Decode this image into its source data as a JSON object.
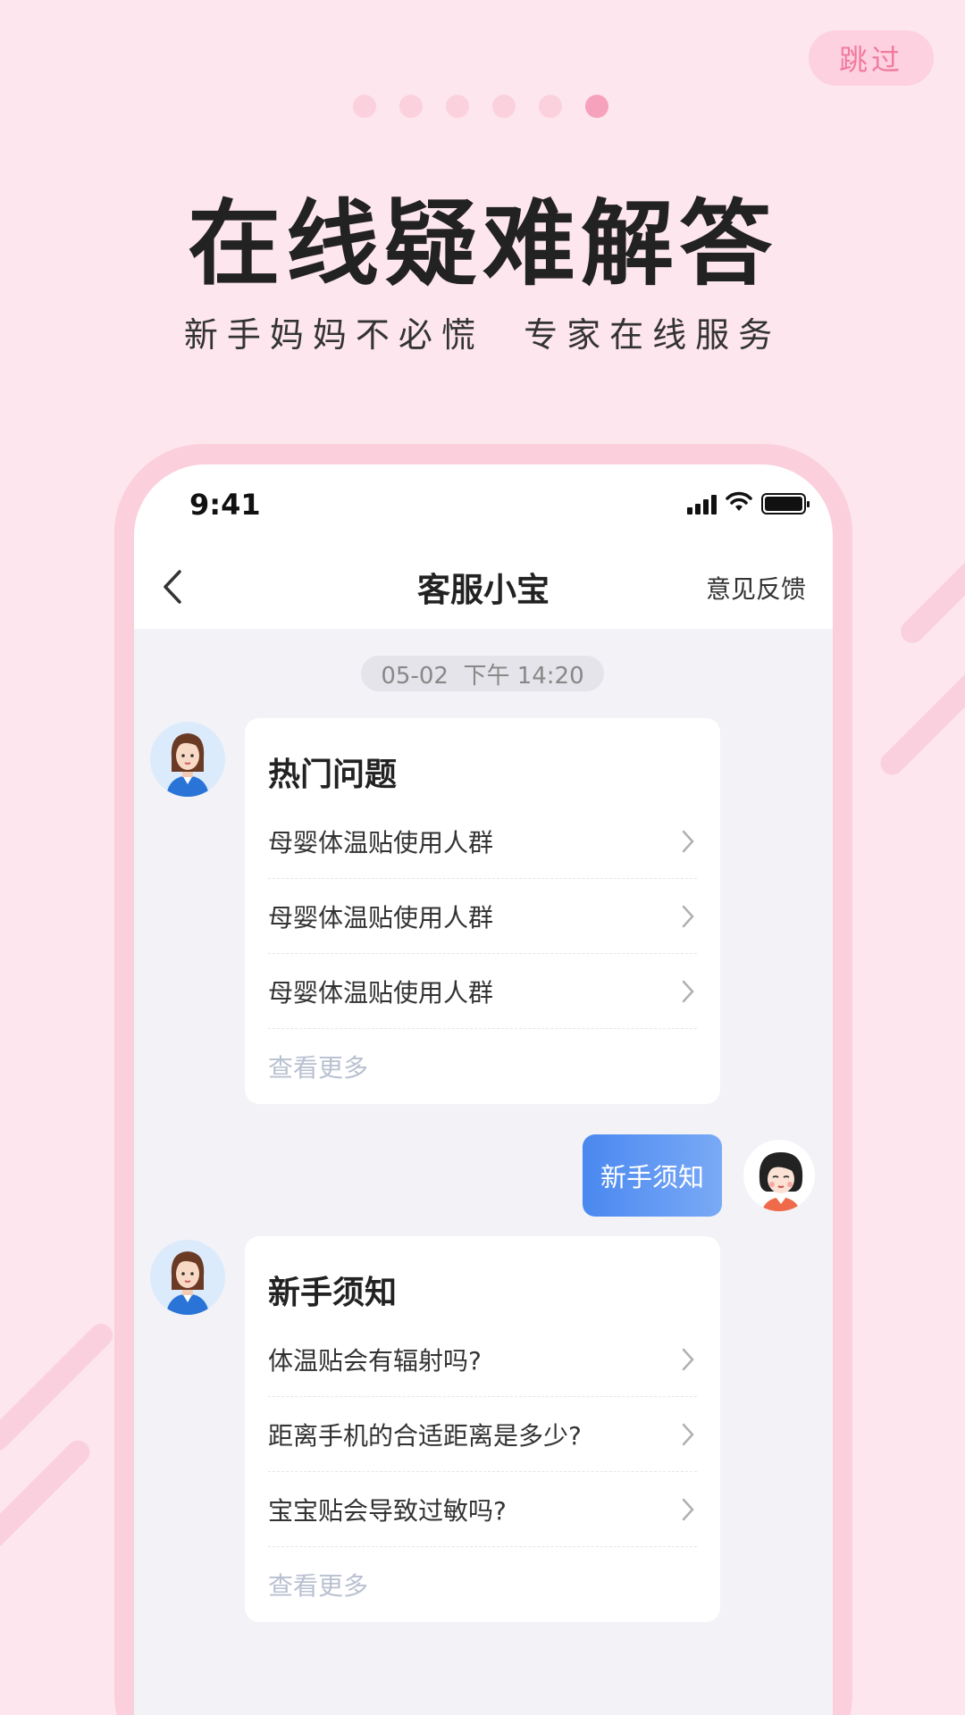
{
  "skip_label": "跳过",
  "pager": {
    "count": 6,
    "active_index": 6
  },
  "headline": "在线疑难解答",
  "subline": "新手妈妈不必慌  专家在线服务",
  "phone": {
    "status": {
      "time": "9:41"
    },
    "nav": {
      "title": "客服小宝",
      "feedback": "意见反馈"
    },
    "timestamp": "05-02  下午 14:20",
    "cards": [
      {
        "title": "热门问题",
        "rows": [
          "母婴体温贴使用人群",
          "母婴体温贴使用人群",
          "母婴体温贴使用人群"
        ],
        "more": "查看更多"
      },
      {
        "title": "新手须知",
        "rows": [
          "体温贴会有辐射吗?",
          "距离手机的合适距离是多少?",
          "宝宝贴会导致过敏吗?"
        ],
        "more": "查看更多"
      }
    ],
    "user_message": "新手须知"
  },
  "colors": {
    "background": "#fde6ee",
    "accent_pink": "#f07aa0",
    "bubble_blue": "#4a88f0",
    "more_link": "#b9c0d0"
  },
  "icons": [
    "back-arrow-icon",
    "signal-icon",
    "wifi-icon",
    "battery-icon",
    "chevron-right-icon",
    "agent-avatar",
    "user-avatar"
  ]
}
